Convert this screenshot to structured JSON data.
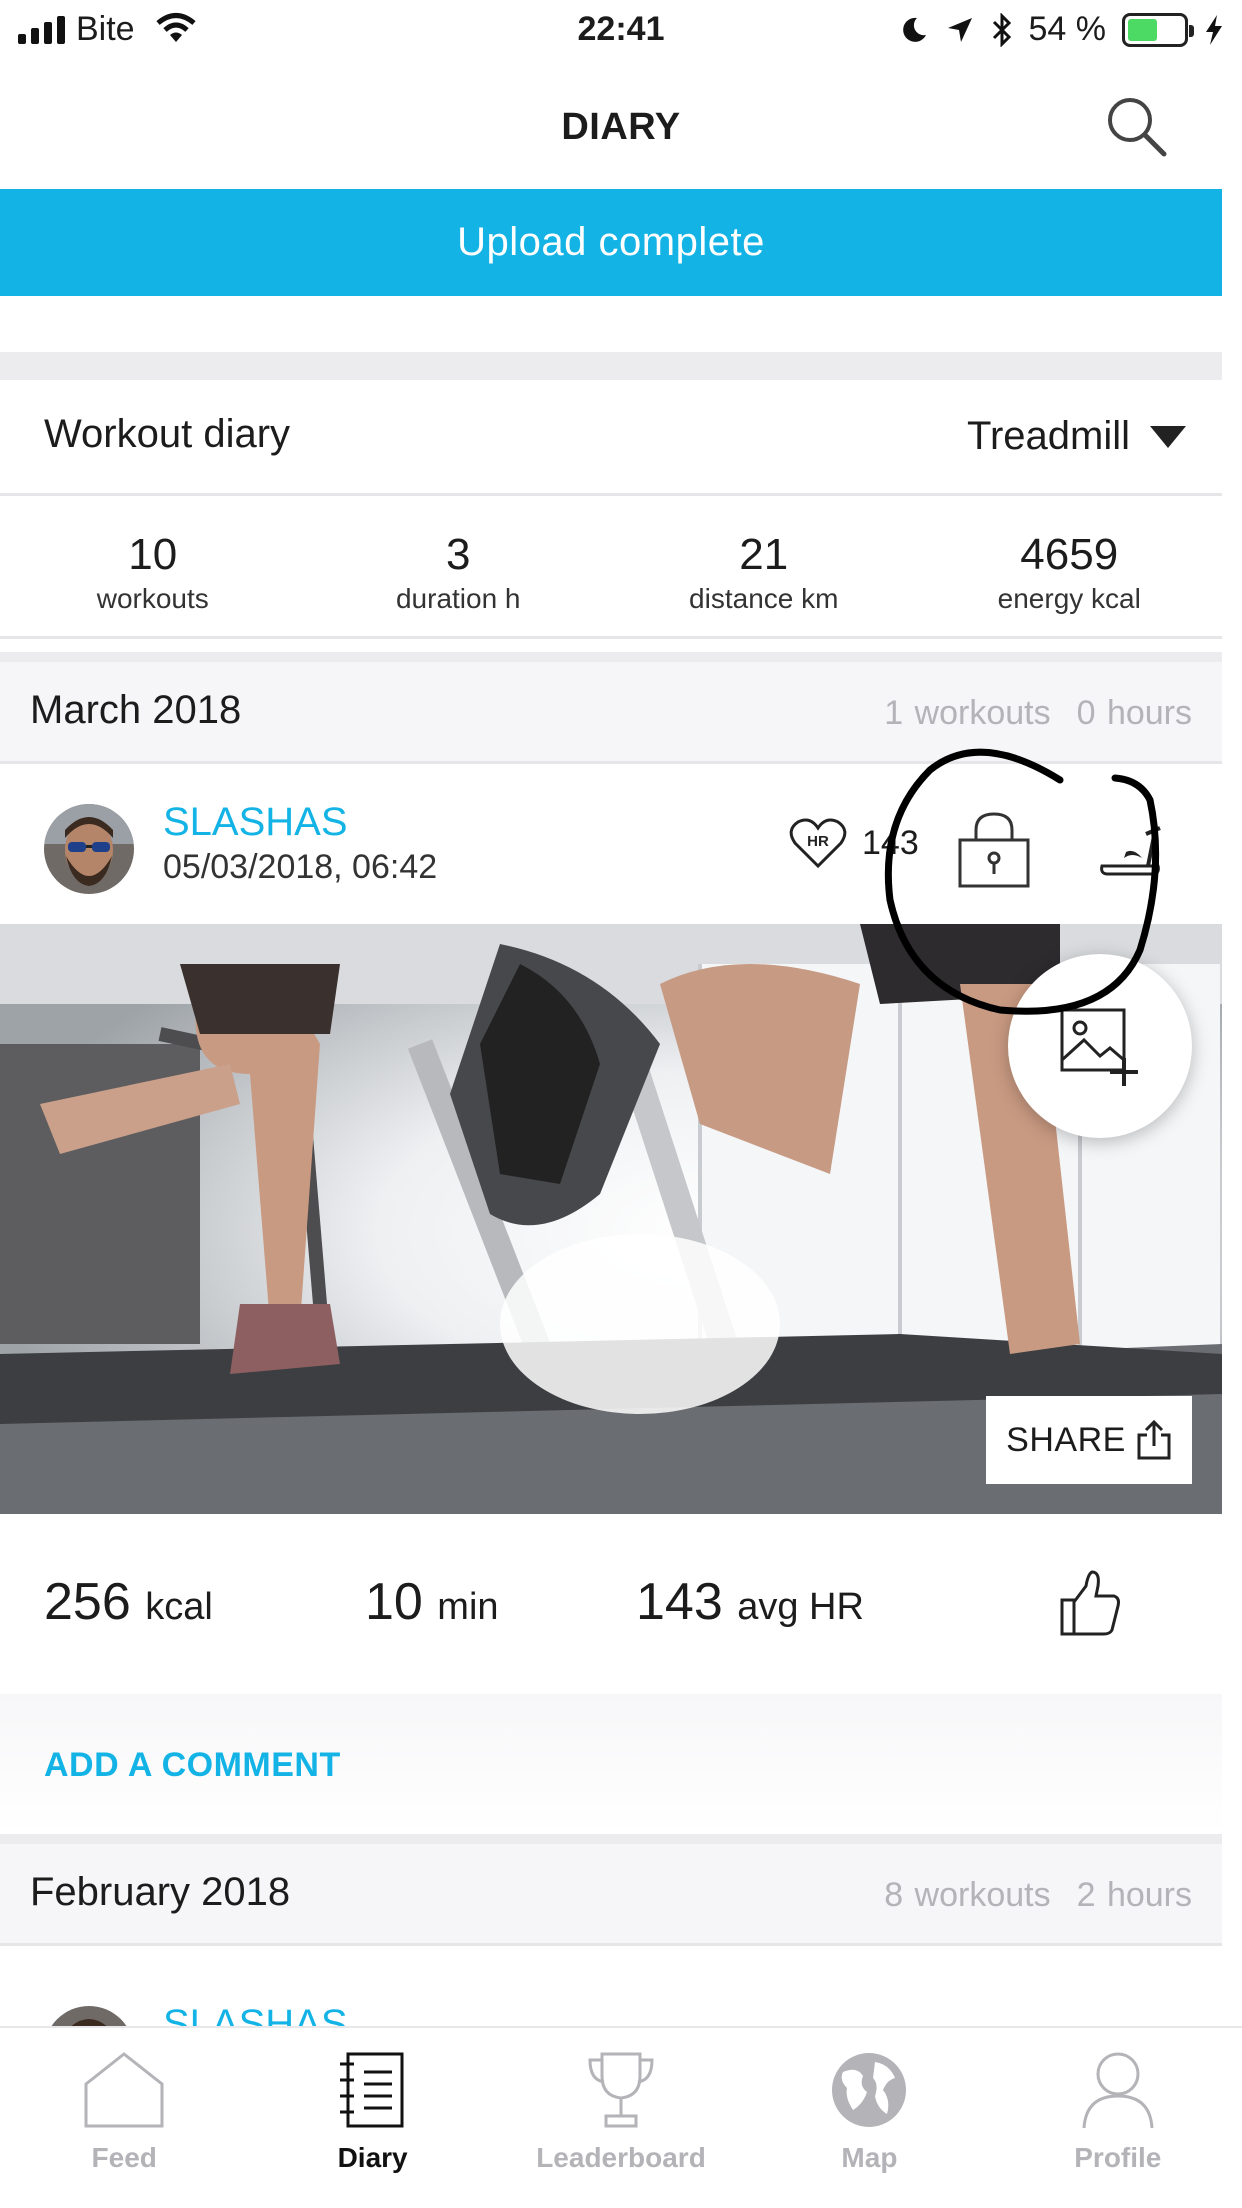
{
  "status_bar": {
    "carrier": "Bite",
    "time": "22:41",
    "battery": "54 %",
    "battery_level": 0.54
  },
  "nav": {
    "title": "DIARY"
  },
  "banner": {
    "text": "Upload complete"
  },
  "diary": {
    "title": "Workout diary",
    "filter": "Treadmill"
  },
  "stats": [
    {
      "value": "10",
      "label": "workouts"
    },
    {
      "value": "3",
      "label": "duration h"
    },
    {
      "value": "21",
      "label": "distance km"
    },
    {
      "value": "4659",
      "label": "energy kcal"
    }
  ],
  "months": [
    {
      "name": "March 2018",
      "workouts": "1 workouts",
      "hours": "0 hours"
    },
    {
      "name": "February 2018",
      "workouts": "8 workouts",
      "hours": "2 hours"
    }
  ],
  "entry": {
    "user": "SLASHAS",
    "datetime": "05/03/2018, 06:42",
    "hr": "143",
    "share": "SHARE",
    "kcal_value": "256",
    "kcal_unit": "kcal",
    "min_value": "10",
    "min_unit": "min",
    "hr_value": "143",
    "hr_unit": "avg HR",
    "comment": "ADD A COMMENT"
  },
  "tabs": [
    {
      "label": "Feed",
      "icon": "home-icon"
    },
    {
      "label": "Diary",
      "icon": "diary-icon",
      "active": true
    },
    {
      "label": "Leaderboard",
      "icon": "trophy-icon"
    },
    {
      "label": "Map",
      "icon": "globe-icon"
    },
    {
      "label": "Profile",
      "icon": "person-icon"
    }
  ]
}
